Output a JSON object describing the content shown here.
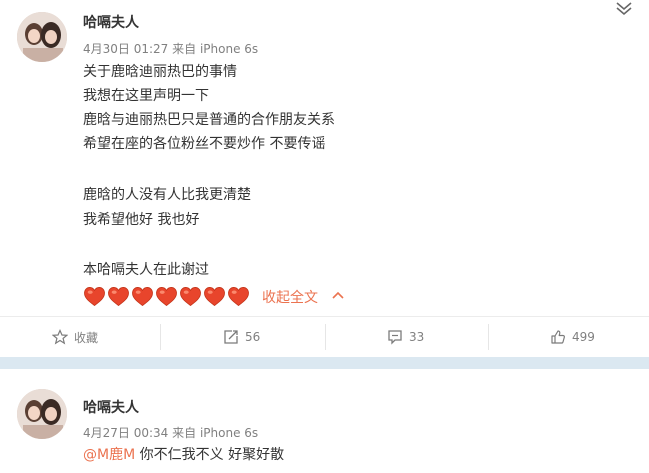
{
  "posts": [
    {
      "username": "哈嗝夫人",
      "timestamp": "4月30日 01:27",
      "source": "来自 iPhone 6s",
      "lines": [
        "关于鹿晗迪丽热巴的事情",
        "我想在这里声明一下",
        "鹿晗与迪丽热巴只是普通的合作朋友关系",
        "希望在座的各位粉丝不要炒作 不要传谣",
        "",
        "鹿晗的人没有人比我更清楚",
        "我希望他好 我也好",
        "",
        "本哈嗝夫人在此谢过"
      ],
      "hearts_count": 7,
      "collapse_label": "收起全文",
      "actions": {
        "favorite_label": "收藏",
        "repost_count": "56",
        "comment_count": "33",
        "like_count": "499"
      }
    },
    {
      "username": "哈嗝夫人",
      "timestamp": "4月27日 00:34",
      "source": "来自 iPhone 6s",
      "mention": "@M鹿M",
      "text": " 你不仁我不义 好聚好散"
    }
  ],
  "icons": {
    "more": "chevron-down-icon",
    "favorite": "star-icon",
    "repost": "repost-icon",
    "comment": "comment-icon",
    "like": "thumbs-up-icon",
    "heart": "heart-emoji"
  },
  "colors": {
    "accent": "#eb7350",
    "meta": "#808080",
    "text": "#333333",
    "separator": "#dbe8f1"
  }
}
